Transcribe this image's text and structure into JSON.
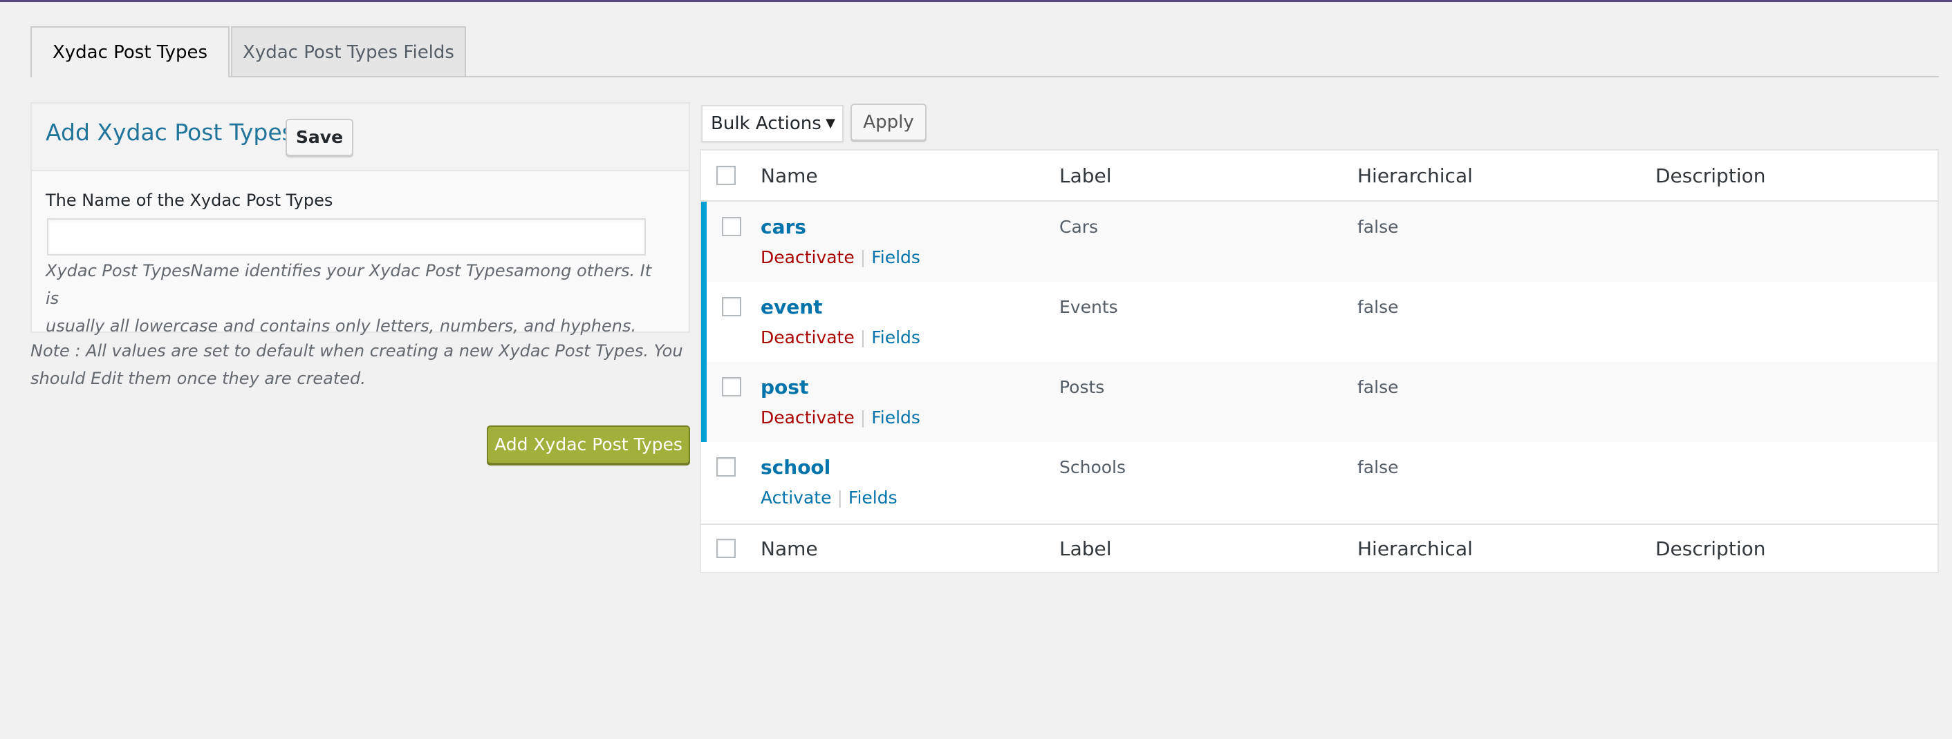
{
  "tabs": [
    {
      "label": "Xydac Post Types",
      "active": true
    },
    {
      "label": "Xydac Post Types Fields",
      "active": false
    }
  ],
  "form": {
    "title": "Add Xydac Post Types",
    "save_label": "Save",
    "field_label": "The Name of the Xydac Post Types",
    "input_value": "",
    "help_line1": "Xydac Post TypesName identifies your Xydac Post Typesamong others. It is",
    "help_line2": "usually all lowercase and contains only letters, numbers, and hyphens.",
    "note_line1": "Note : All values are set to default when creating a new Xydac Post Types. You",
    "note_line2": "should Edit them once they are created.",
    "add_label": "Add Xydac Post Types"
  },
  "toolbar": {
    "bulk_selected": "Bulk Actions",
    "apply_label": "Apply"
  },
  "table": {
    "columns": [
      "Name",
      "Label",
      "Hierarchical",
      "Description"
    ],
    "rows": [
      {
        "name": "cars",
        "label": "Cars",
        "hierarchical": "false",
        "description": "",
        "action": "Deactivate",
        "fields": "Fields",
        "active": true
      },
      {
        "name": "event",
        "label": "Events",
        "hierarchical": "false",
        "description": "",
        "action": "Deactivate",
        "fields": "Fields",
        "active": true
      },
      {
        "name": "post",
        "label": "Posts",
        "hierarchical": "false",
        "description": "",
        "action": "Deactivate",
        "fields": "Fields",
        "active": true
      },
      {
        "name": "school",
        "label": "Schools",
        "hierarchical": "false",
        "description": "",
        "action": "Activate",
        "fields": "Fields",
        "active": false
      }
    ]
  },
  "colors": {
    "accent": "#0073aa",
    "active_bar": "#00a0d2",
    "deactivate": "#aa0000",
    "add_button": "#a0b03b"
  }
}
